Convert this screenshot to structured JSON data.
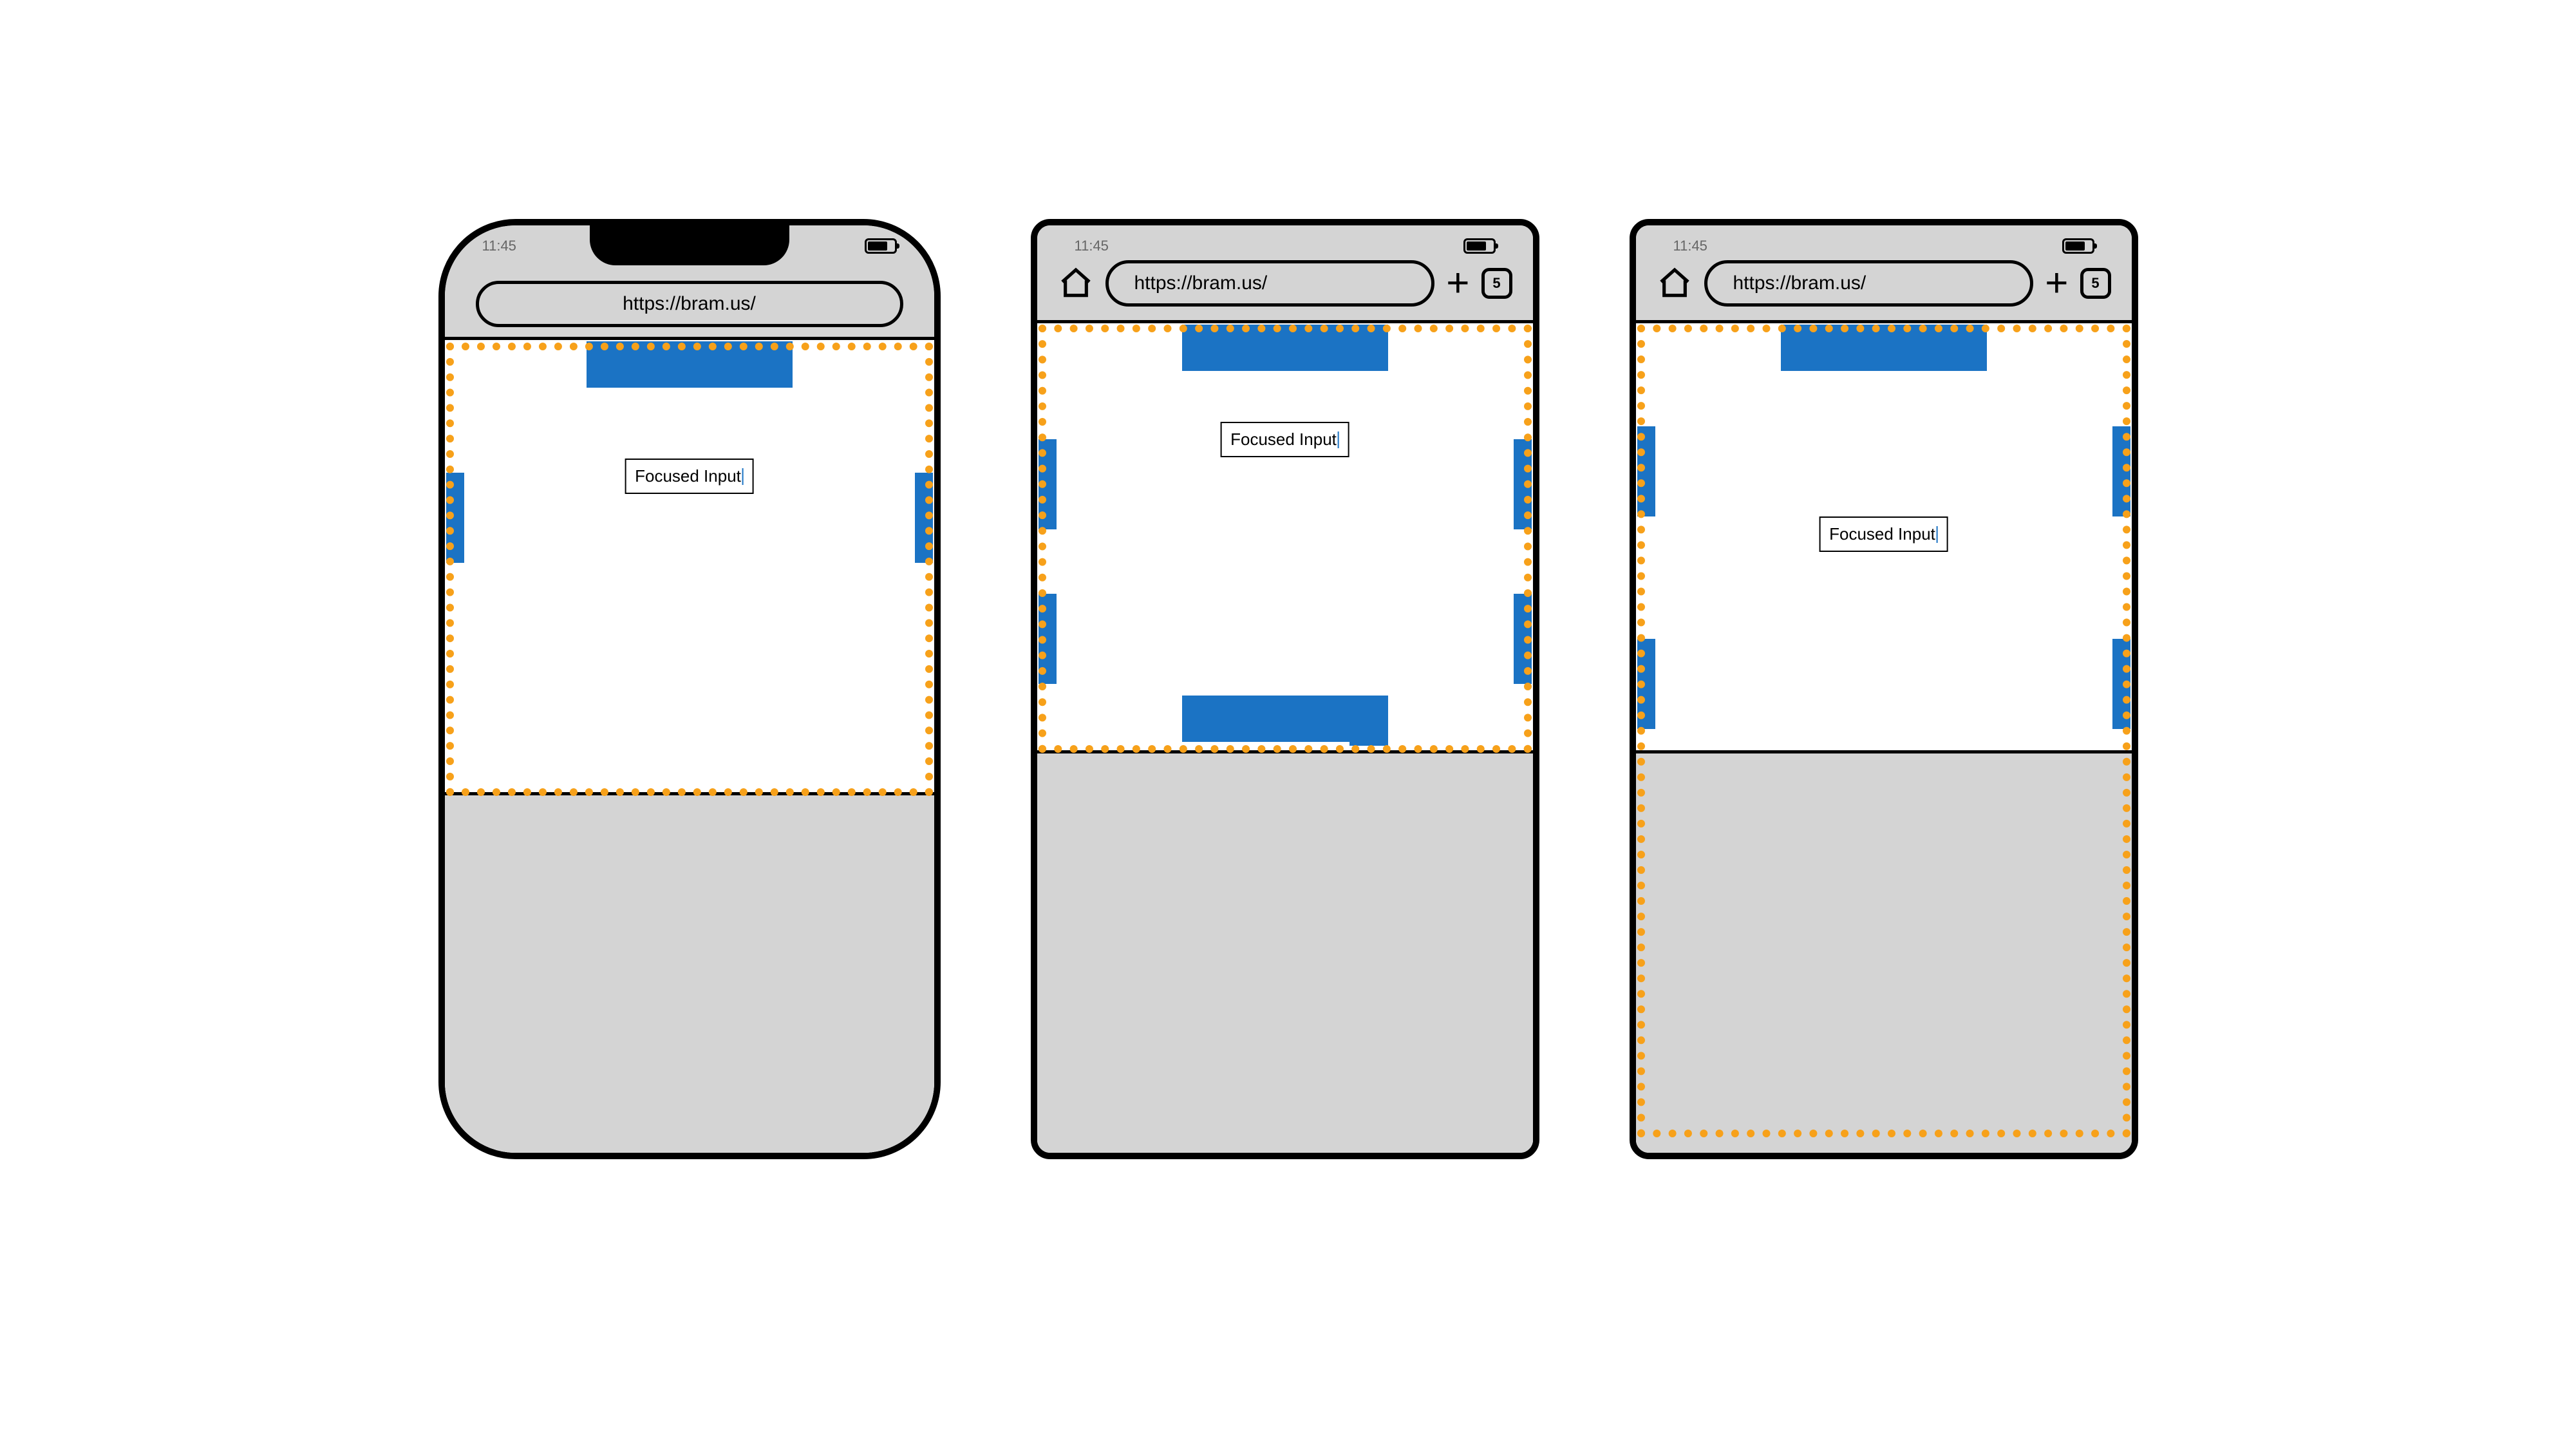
{
  "status": {
    "time": "11:45"
  },
  "url": "https://bram.us/",
  "tab_count": "5",
  "input_label": "Focused Input",
  "colors": {
    "blue": "#1b73c4",
    "orange": "#f7a11a",
    "chrome_grey": "#d4d4d4"
  }
}
